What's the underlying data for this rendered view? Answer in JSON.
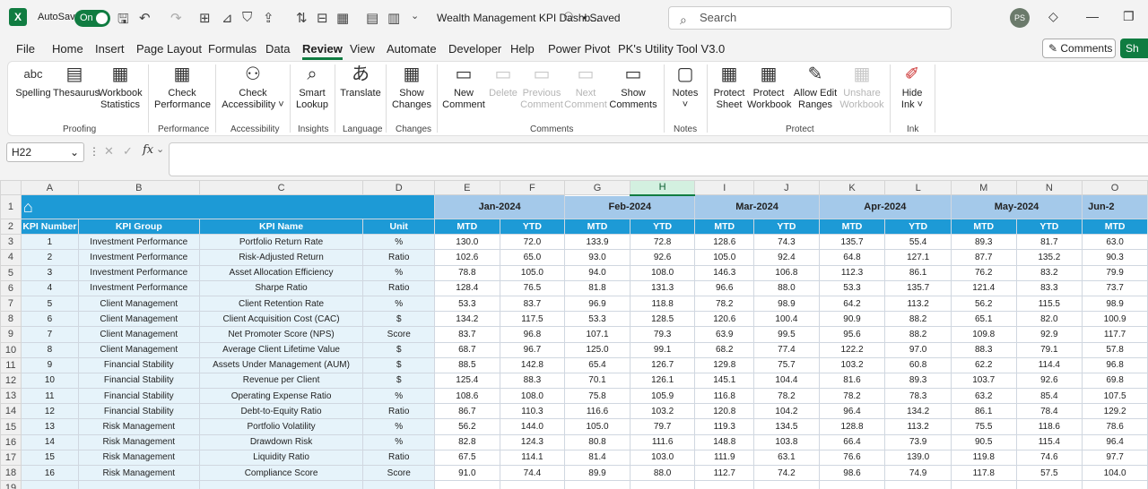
{
  "titlebar": {
    "autosave_label": "AutoSave",
    "autosave_state": "On",
    "doc_title": "Wealth Management KPI Dashb...",
    "saved": "• Saved",
    "search_placeholder": "Search",
    "user_initials": "PS"
  },
  "menu": [
    "File",
    "Home",
    "Insert",
    "Page Layout",
    "Formulas",
    "Data",
    "Review",
    "View",
    "Automate",
    "Developer",
    "Help",
    "Power Pivot",
    "PK's Utility Tool V3.0"
  ],
  "menu_active": "Review",
  "comments_btn": "Comments",
  "share_btn": "Sh",
  "ribbon": {
    "groups": [
      "Proofing",
      "Performance",
      "Accessibility",
      "Insights",
      "Language",
      "Changes",
      "Comments",
      "Notes",
      "Protect",
      "Ink"
    ],
    "buttons": [
      {
        "l1": "Spelling",
        "l2": "",
        "icon": "abc"
      },
      {
        "l1": "Thesaurus",
        "l2": "",
        "icon": "▤"
      },
      {
        "l1": "Workbook",
        "l2": "Statistics",
        "icon": "▦"
      },
      {
        "l1": "Check",
        "l2": "Performance",
        "icon": "▦"
      },
      {
        "l1": "Check",
        "l2": "Accessibility ˅",
        "icon": "⚇"
      },
      {
        "l1": "Smart",
        "l2": "Lookup",
        "icon": "⌕"
      },
      {
        "l1": "Translate",
        "l2": "",
        "icon": "あ"
      },
      {
        "l1": "Show",
        "l2": "Changes",
        "icon": "▦"
      },
      {
        "l1": "New",
        "l2": "Comment",
        "icon": "▭"
      },
      {
        "l1": "Delete",
        "l2": "",
        "icon": "▭"
      },
      {
        "l1": "Previous",
        "l2": "Comment",
        "icon": "▭"
      },
      {
        "l1": "Next",
        "l2": "Comment",
        "icon": "▭"
      },
      {
        "l1": "Show",
        "l2": "Comments",
        "icon": "▭"
      },
      {
        "l1": "Notes",
        "l2": "˅",
        "icon": "▢"
      },
      {
        "l1": "Protect",
        "l2": "Sheet",
        "icon": "▦"
      },
      {
        "l1": "Protect",
        "l2": "Workbook",
        "icon": "▦"
      },
      {
        "l1": "Allow Edit",
        "l2": "Ranges",
        "icon": "✎"
      },
      {
        "l1": "Unshare",
        "l2": "Workbook",
        "icon": "▦"
      },
      {
        "l1": "Hide",
        "l2": "Ink ˅",
        "icon": "✐"
      }
    ]
  },
  "formula_bar": {
    "name_box": "H22",
    "fx": "fx",
    "value": ""
  },
  "columns": [
    "A",
    "B",
    "C",
    "D",
    "E",
    "F",
    "G",
    "H",
    "I",
    "J",
    "K",
    "L",
    "M",
    "N",
    "O"
  ],
  "selected_column": "H",
  "row_numbers": [
    "1",
    "2",
    "3",
    "4",
    "5",
    "6",
    "7",
    "8",
    "9",
    "10",
    "11",
    "12",
    "13",
    "14",
    "15",
    "16",
    "17",
    "18",
    "19"
  ],
  "months": [
    "Jan-2024",
    "Feb-2024",
    "Mar-2024",
    "Apr-2024",
    "May-2024",
    "Jun-2"
  ],
  "headers": {
    "kpi_number": "KPI Number",
    "kpi_group": "KPI Group",
    "kpi_name": "KPI Name",
    "unit": "Unit",
    "mtd": "MTD",
    "ytd": "YTD"
  },
  "rows": [
    [
      "1",
      "Investment Performance",
      "Portfolio Return Rate",
      "%",
      "130.0",
      "72.0",
      "133.9",
      "72.8",
      "128.6",
      "74.3",
      "135.7",
      "55.4",
      "89.3",
      "81.7",
      "63.0"
    ],
    [
      "2",
      "Investment Performance",
      "Risk-Adjusted Return",
      "Ratio",
      "102.6",
      "65.0",
      "93.0",
      "92.6",
      "105.0",
      "92.4",
      "64.8",
      "127.1",
      "87.7",
      "135.2",
      "90.3"
    ],
    [
      "3",
      "Investment Performance",
      "Asset Allocation Efficiency",
      "%",
      "78.8",
      "105.0",
      "94.0",
      "108.0",
      "146.3",
      "106.8",
      "112.3",
      "86.1",
      "76.2",
      "83.2",
      "79.9"
    ],
    [
      "4",
      "Investment Performance",
      "Sharpe Ratio",
      "Ratio",
      "128.4",
      "76.5",
      "81.8",
      "131.3",
      "96.6",
      "88.0",
      "53.3",
      "135.7",
      "121.4",
      "83.3",
      "73.7"
    ],
    [
      "5",
      "Client Management",
      "Client Retention Rate",
      "%",
      "53.3",
      "83.7",
      "96.9",
      "118.8",
      "78.2",
      "98.9",
      "64.2",
      "113.2",
      "56.2",
      "115.5",
      "98.9"
    ],
    [
      "6",
      "Client Management",
      "Client Acquisition Cost (CAC)",
      "$",
      "134.2",
      "117.5",
      "53.3",
      "128.5",
      "120.6",
      "100.4",
      "90.9",
      "88.2",
      "65.1",
      "82.0",
      "100.9"
    ],
    [
      "7",
      "Client Management",
      "Net Promoter Score (NPS)",
      "Score",
      "83.7",
      "96.8",
      "107.1",
      "79.3",
      "63.9",
      "99.5",
      "95.6",
      "88.2",
      "109.8",
      "92.9",
      "117.7"
    ],
    [
      "8",
      "Client Management",
      "Average Client Lifetime Value",
      "$",
      "68.7",
      "96.7",
      "125.0",
      "99.1",
      "68.2",
      "77.4",
      "122.2",
      "97.0",
      "88.3",
      "79.1",
      "57.8"
    ],
    [
      "9",
      "Financial Stability",
      "Assets Under Management (AUM)",
      "$",
      "88.5",
      "142.8",
      "65.4",
      "126.7",
      "129.8",
      "75.7",
      "103.2",
      "60.8",
      "62.2",
      "114.4",
      "96.8"
    ],
    [
      "10",
      "Financial Stability",
      "Revenue per Client",
      "$",
      "125.4",
      "88.3",
      "70.1",
      "126.1",
      "145.1",
      "104.4",
      "81.6",
      "89.3",
      "103.7",
      "92.6",
      "69.8"
    ],
    [
      "11",
      "Financial Stability",
      "Operating Expense Ratio",
      "%",
      "108.6",
      "108.0",
      "75.8",
      "105.9",
      "116.8",
      "78.2",
      "78.2",
      "78.3",
      "63.2",
      "85.4",
      "107.5"
    ],
    [
      "12",
      "Financial Stability",
      "Debt-to-Equity Ratio",
      "Ratio",
      "86.7",
      "110.3",
      "116.6",
      "103.2",
      "120.8",
      "104.2",
      "96.4",
      "134.2",
      "86.1",
      "78.4",
      "129.2"
    ],
    [
      "13",
      "Risk Management",
      "Portfolio Volatility",
      "%",
      "56.2",
      "144.0",
      "105.0",
      "79.7",
      "119.3",
      "134.5",
      "128.8",
      "113.2",
      "75.5",
      "118.6",
      "78.6"
    ],
    [
      "14",
      "Risk Management",
      "Drawdown Risk",
      "%",
      "82.8",
      "124.3",
      "80.8",
      "111.6",
      "148.8",
      "103.8",
      "66.4",
      "73.9",
      "90.5",
      "115.4",
      "96.4"
    ],
    [
      "15",
      "Risk Management",
      "Liquidity Ratio",
      "Ratio",
      "67.5",
      "114.1",
      "81.4",
      "103.0",
      "111.9",
      "63.1",
      "76.6",
      "139.0",
      "119.8",
      "74.6",
      "97.7"
    ],
    [
      "16",
      "Risk Management",
      "Compliance Score",
      "Score",
      "91.0",
      "74.4",
      "89.9",
      "88.0",
      "112.7",
      "74.2",
      "98.6",
      "74.9",
      "117.8",
      "57.5",
      "104.0"
    ]
  ]
}
